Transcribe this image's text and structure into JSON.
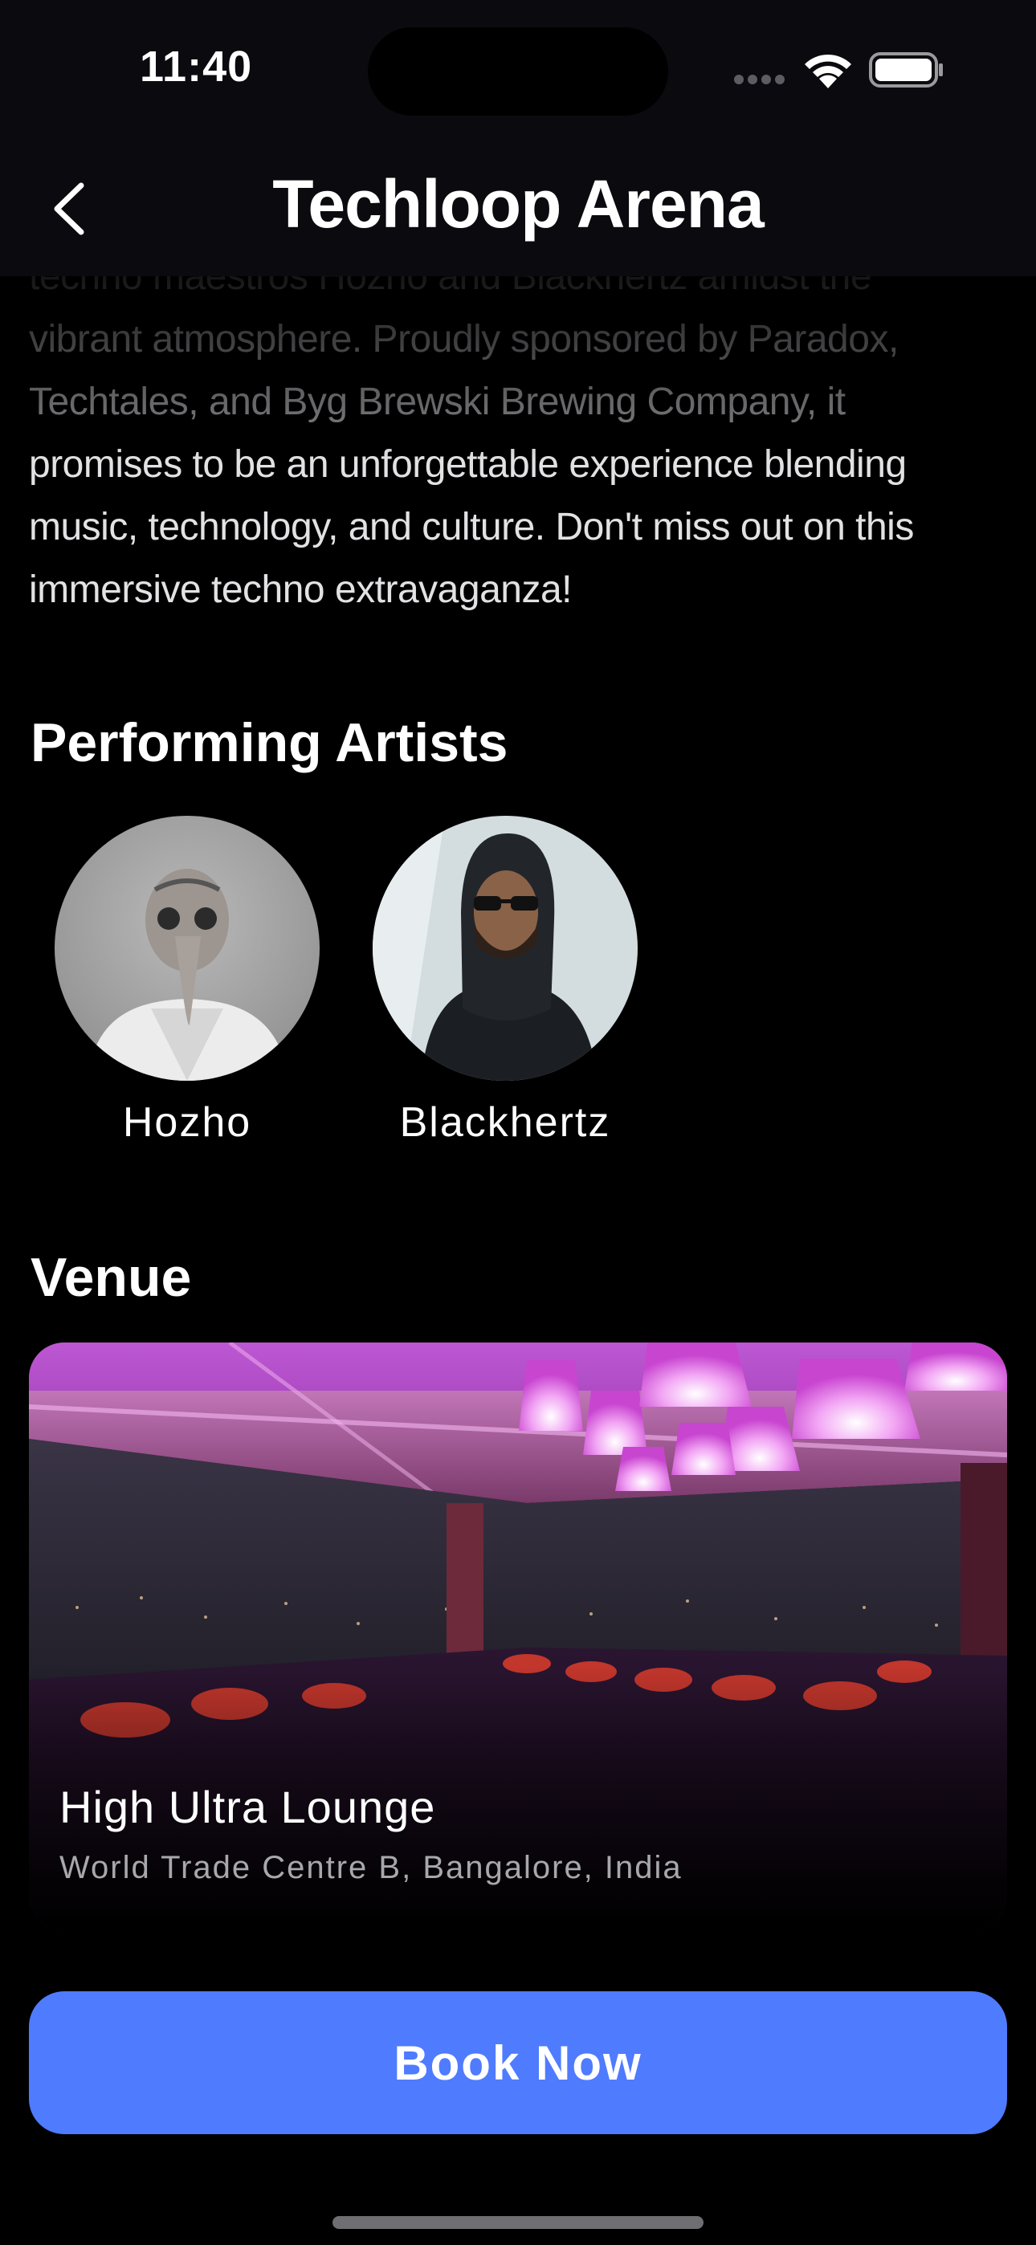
{
  "status_bar": {
    "time": "11:40",
    "signal_icon": "cellular-dots-icon",
    "wifi_icon": "wifi-icon",
    "battery_icon": "battery-icon"
  },
  "nav": {
    "title": "Techloop Arena",
    "back_icon": "chevron-left-icon"
  },
  "description": {
    "partial_line": "techno maestros Hozho and Blackhertz amidst the",
    "faded_lines": "vibrant atmosphere. Proudly sponsored by Paradox, Techtales, and Byg Brewski Brewing Company, it",
    "lines": "promises to be an unforgettable experience blending music, technology, and culture. Don't miss out on this immersive techno extravaganza!"
  },
  "artists": {
    "title": "Performing Artists",
    "items": [
      {
        "name": "Hozho"
      },
      {
        "name": "Blackhertz"
      }
    ]
  },
  "venue": {
    "title": "Venue",
    "name": "High Ultra Lounge",
    "address": "World Trade Centre B, Bangalore, India"
  },
  "cta": {
    "label": "Book Now",
    "color": "#4f7bff"
  }
}
